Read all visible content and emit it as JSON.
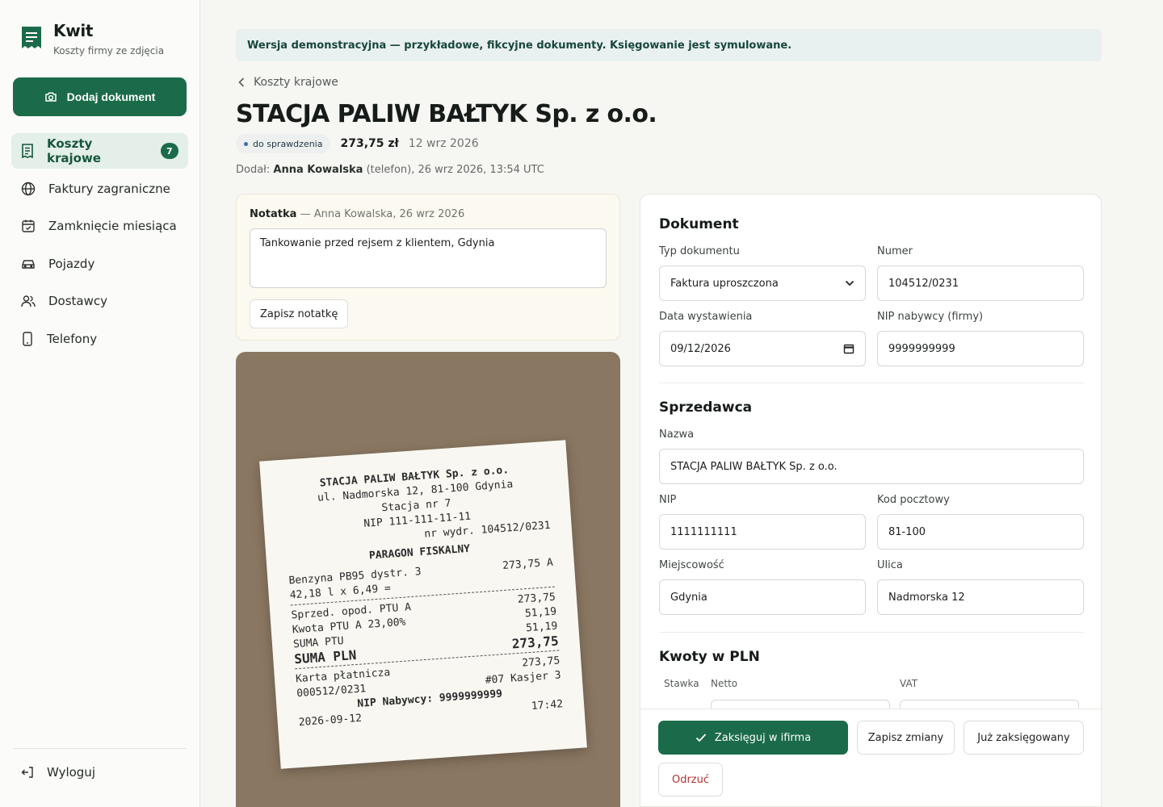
{
  "app": {
    "title": "Kwit",
    "subtitle": "Koszty firmy ze zdjęcia"
  },
  "sidebar": {
    "add_label": "Dodaj dokument",
    "items": [
      {
        "label": "Koszty krajowe",
        "badge": "7",
        "active": true,
        "icon": "receipt-icon"
      },
      {
        "label": "Faktury zagraniczne",
        "icon": "globe-icon"
      },
      {
        "label": "Zamknięcie miesiąca",
        "icon": "calendar-check-icon"
      },
      {
        "label": "Pojazdy",
        "icon": "car-icon"
      },
      {
        "label": "Dostawcy",
        "icon": "users-icon"
      },
      {
        "label": "Telefony",
        "icon": "phone-icon"
      }
    ],
    "logout_label": "Wyloguj"
  },
  "banner": "Wersja demonstracyjna — przykładowe, fikcyjne dokumenty. Księgowanie jest symulowane.",
  "breadcrumb": "Koszty krajowe",
  "doc": {
    "title": "STACJA PALIW BAŁTYK Sp. z o.o.",
    "status": "do sprawdzenia",
    "amount": "273,75 zł",
    "date": "12 wrz 2026",
    "added_prefix": "Dodał:",
    "added_by": "Anna Kowalska",
    "added_suffix": "(telefon), 26 wrz 2026, 13:54 UTC"
  },
  "note": {
    "label": "Notatka",
    "meta": "— Anna Kowalska, 26 wrz 2026",
    "text": "Tankowanie przed rejsem z klientem, Gdynia",
    "save_label": "Zapisz notatkę"
  },
  "receipt": {
    "lines_center": [
      "STACJA PALIW BAŁTYK Sp. z o.o.",
      "ul. Nadmorska 12, 81-100 Gdynia",
      "Stacja nr 7",
      "NIP 111-111-11-11"
    ],
    "nr": "nr wydr. 104512/0231",
    "header": "PARAGON FISKALNY",
    "item_name": "Benzyna PB95 dystr. 3",
    "item_total": "273,75 A",
    "item_qty": "42,18 l x 6,49 =",
    "sale_label": "Sprzed. opod. PTU A",
    "sale_value": "273,75",
    "vat_label": "Kwota PTU A 23,00%",
    "vat_value": "51,19",
    "vat_sum_label": "SUMA PTU",
    "vat_sum_value": "51,19",
    "total_value": "273,75",
    "total_label": "SUMA PLN",
    "card_value": "273,75",
    "card_label": "Karta płatnicza",
    "cashier": "#07 Kasjer 3",
    "ref": "000512/0231",
    "buyer_nip": "NIP Nabywcy: 9999999999",
    "time": "17:42",
    "date": "2026-09-12"
  },
  "form": {
    "section_doc": "Dokument",
    "type_label": "Typ dokumentu",
    "type_value": "Faktura uproszczona",
    "number_label": "Numer",
    "number_value": "104512/0231",
    "issue_label": "Data wystawienia",
    "issue_value": "09/12/2026",
    "buyer_nip_label": "NIP nabywcy (firmy)",
    "buyer_nip_value": "9999999999",
    "section_seller": "Sprzedawca",
    "name_label": "Nazwa",
    "name_value": "STACJA PALIW BAŁTYK Sp. z o.o.",
    "nip_label": "NIP",
    "nip_value": "1111111111",
    "zip_label": "Kod pocztowy",
    "zip_value": "81-100",
    "city_label": "Miejscowość",
    "city_value": "Gdynia",
    "street_label": "Ulica",
    "street_value": "Nadmorska 12",
    "section_amounts": "Kwoty w PLN",
    "col_rate": "Stawka",
    "col_net": "Netto",
    "col_vat": "VAT"
  },
  "actions": {
    "post_label": "Zaksięguj w ifirma",
    "save_label": "Zapisz zmiany",
    "already_label": "Już zaksięgowany",
    "reject_label": "Odrzuć"
  },
  "colors": {
    "accent": "#1b6b4a",
    "reject": "#b3342f",
    "photo_bg": "#8a7761"
  }
}
